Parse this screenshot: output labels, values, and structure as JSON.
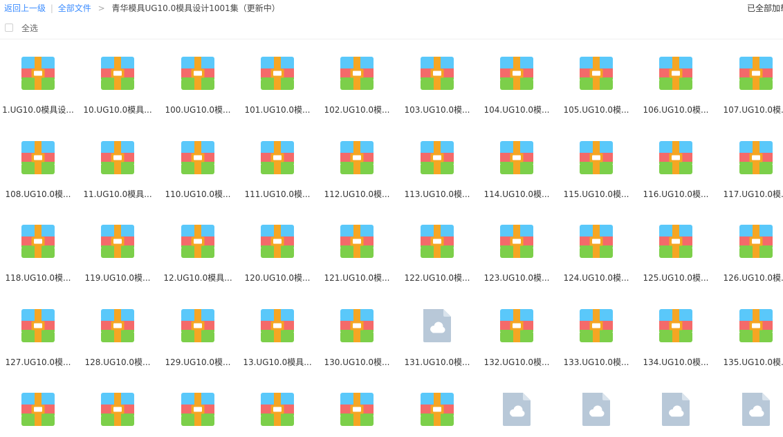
{
  "header": {
    "back_label": "返回上一级",
    "all_files_label": "全部文件",
    "separator": "|",
    "arrow": ">",
    "current_folder": "青华模具UG10.0模具设计1001集（更新中）",
    "loaded_status": "已全部加载"
  },
  "select_all": {
    "label": "全选"
  },
  "colors": {
    "link": "#3b8cff",
    "archive_blue": "#5ac8fa",
    "archive_red": "#f46a6a",
    "archive_green": "#7ccf4a",
    "archive_strap": "#f5a623",
    "cloud_file": "#b8c8d8"
  },
  "files": [
    {
      "name": "1.UG10.0模具设...",
      "icon": "archive-icon"
    },
    {
      "name": "10.UG10.0模具...",
      "icon": "archive-icon"
    },
    {
      "name": "100.UG10.0模...",
      "icon": "archive-icon"
    },
    {
      "name": "101.UG10.0模...",
      "icon": "archive-icon"
    },
    {
      "name": "102.UG10.0模...",
      "icon": "archive-icon"
    },
    {
      "name": "103.UG10.0模...",
      "icon": "archive-icon"
    },
    {
      "name": "104.UG10.0模...",
      "icon": "archive-icon"
    },
    {
      "name": "105.UG10.0模...",
      "icon": "archive-icon"
    },
    {
      "name": "106.UG10.0模...",
      "icon": "archive-icon"
    },
    {
      "name": "107.UG10.0模...",
      "icon": "archive-icon"
    },
    {
      "name": "108.UG10.0模...",
      "icon": "archive-icon"
    },
    {
      "name": "11.UG10.0模具...",
      "icon": "archive-icon"
    },
    {
      "name": "110.UG10.0模...",
      "icon": "archive-icon"
    },
    {
      "name": "111.UG10.0模...",
      "icon": "archive-icon"
    },
    {
      "name": "112.UG10.0模...",
      "icon": "archive-icon"
    },
    {
      "name": "113.UG10.0模...",
      "icon": "archive-icon"
    },
    {
      "name": "114.UG10.0模...",
      "icon": "archive-icon"
    },
    {
      "name": "115.UG10.0模...",
      "icon": "archive-icon"
    },
    {
      "name": "116.UG10.0模...",
      "icon": "archive-icon"
    },
    {
      "name": "117.UG10.0模...",
      "icon": "archive-icon"
    },
    {
      "name": "118.UG10.0模...",
      "icon": "archive-icon"
    },
    {
      "name": "119.UG10.0模...",
      "icon": "archive-icon"
    },
    {
      "name": "12.UG10.0模具...",
      "icon": "archive-icon"
    },
    {
      "name": "120.UG10.0模...",
      "icon": "archive-icon"
    },
    {
      "name": "121.UG10.0模...",
      "icon": "archive-icon"
    },
    {
      "name": "122.UG10.0模...",
      "icon": "archive-icon"
    },
    {
      "name": "123.UG10.0模...",
      "icon": "archive-icon"
    },
    {
      "name": "124.UG10.0模...",
      "icon": "archive-icon"
    },
    {
      "name": "125.UG10.0模...",
      "icon": "archive-icon"
    },
    {
      "name": "126.UG10.0模...",
      "icon": "archive-icon"
    },
    {
      "name": "127.UG10.0模...",
      "icon": "archive-icon"
    },
    {
      "name": "128.UG10.0模...",
      "icon": "archive-icon"
    },
    {
      "name": "129.UG10.0模...",
      "icon": "archive-icon"
    },
    {
      "name": "13.UG10.0模具...",
      "icon": "archive-icon"
    },
    {
      "name": "130.UG10.0模...",
      "icon": "archive-icon"
    },
    {
      "name": "131.UG10.0模...",
      "icon": "cloud-file-icon"
    },
    {
      "name": "132.UG10.0模...",
      "icon": "archive-icon"
    },
    {
      "name": "133.UG10.0模...",
      "icon": "archive-icon"
    },
    {
      "name": "134.UG10.0模...",
      "icon": "archive-icon"
    },
    {
      "name": "135.UG10.0模...",
      "icon": "archive-icon"
    },
    {
      "name": "",
      "icon": "archive-icon"
    },
    {
      "name": "",
      "icon": "archive-icon"
    },
    {
      "name": "",
      "icon": "archive-icon"
    },
    {
      "name": "",
      "icon": "archive-icon"
    },
    {
      "name": "",
      "icon": "archive-icon"
    },
    {
      "name": "",
      "icon": "archive-icon"
    },
    {
      "name": "",
      "icon": "cloud-file-icon"
    },
    {
      "name": "",
      "icon": "cloud-file-icon"
    },
    {
      "name": "",
      "icon": "cloud-file-icon"
    },
    {
      "name": "",
      "icon": "cloud-file-icon"
    }
  ]
}
